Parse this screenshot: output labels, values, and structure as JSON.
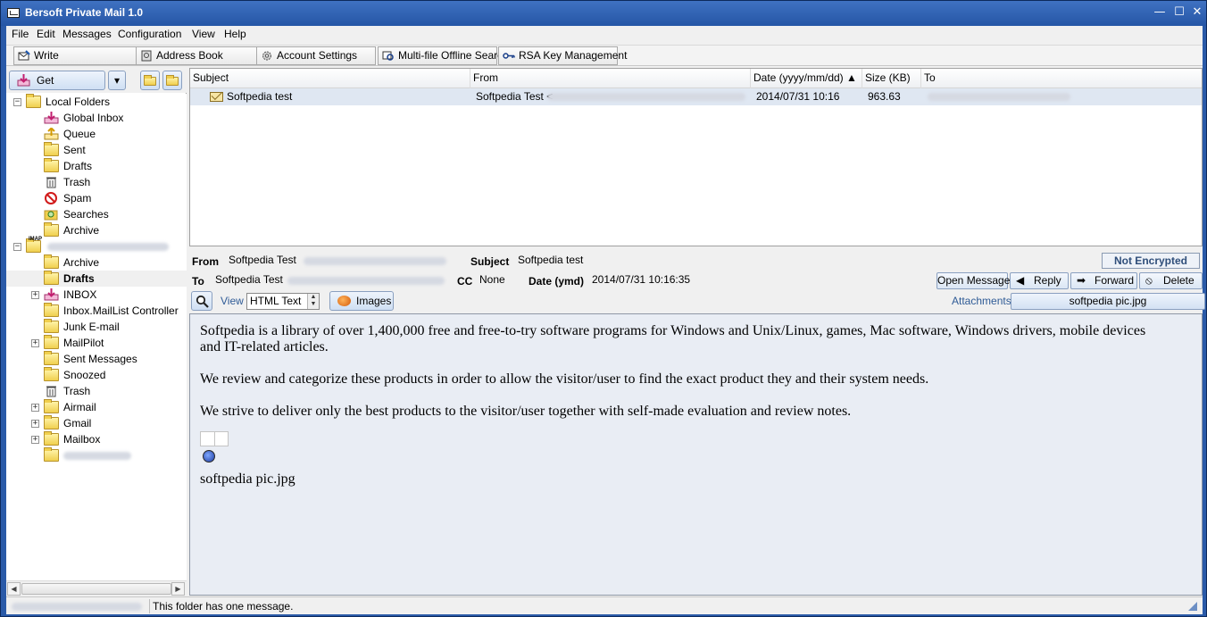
{
  "window": {
    "title": "Bersoft Private Mail 1.0",
    "min": "—",
    "max": "☐",
    "close": "✕"
  },
  "menu": [
    "File",
    "Edit",
    "Messages",
    "Configuration",
    "View",
    "Help"
  ],
  "toolbar": {
    "write": "Write",
    "address_book": "Address Book",
    "account_settings": "Account Settings",
    "offline_search": "Multi-file Offline Search",
    "rsa": "RSA Key Management"
  },
  "left": {
    "get_messages": "Get Messages",
    "dropdown_arrow": "▾",
    "local_root": "Local Folders",
    "local_folders": [
      "Global Inbox",
      "Queue",
      "Sent",
      "Drafts",
      "Trash",
      "Spam",
      "Searches",
      "Archive"
    ],
    "account_folders": [
      "Archive",
      "Drafts",
      "INBOX",
      "Inbox.MailList Controller",
      "Junk E-mail",
      "MailPilot",
      "Sent Messages",
      "Snoozed",
      "Trash",
      "Airmail",
      "Gmail",
      "Mailbox"
    ],
    "selected": "Drafts",
    "imap_badge": "IMAP",
    "expander_minus": "−",
    "expander_plus": "+",
    "scroll_left": "◀",
    "scroll_right": "▶"
  },
  "list": {
    "columns": [
      "Subject",
      "From",
      "Date (yyyy/mm/dd) ▲",
      "Size (KB)",
      "To"
    ],
    "rows": [
      {
        "subject": "Softpedia test",
        "from": "Softpedia Test <",
        "date": "2014/07/31 10:16",
        "size": "963.63"
      }
    ]
  },
  "header": {
    "from_label": "From",
    "from_value": "Softpedia Test",
    "subject_label": "Subject",
    "subject_value": "Softpedia test",
    "to_label": "To",
    "to_value": "Softpedia Test",
    "cc_label": "CC",
    "cc_value": "None",
    "date_label": "Date (ymd)",
    "date_value": "2014/07/31 10:16:35",
    "encryption": "Not Encrypted",
    "open_message": "Open Message",
    "reply": "Reply",
    "forward": "Forward",
    "delete": "Delete",
    "reply_icon": "◀",
    "forward_icon": "➡",
    "delete_icon": "⦸",
    "view_label": "View",
    "view_mode": "HTML Text",
    "spin_up": "▲",
    "spin_down": "▼",
    "images": "Images",
    "attachments_label": "Attachments",
    "attachment_file": "softpedia pic.jpg"
  },
  "body": {
    "p1": "Softpedia is a library of over 1,400,000 free and free-to-try software  programs for Windows and Unix/Linux, games, Mac software, Windows drivers, mobile devices and IT-related articles.",
    "p2": "We review and categorize these products in order to allow the visitor/user  to find the exact product they and their system needs.",
    "p3": "We strive to deliver only the best products to the visitor/user together with self-made evaluation and review notes.",
    "image_caption": "softpedia pic.jpg"
  },
  "status": {
    "message": "This folder has one message."
  },
  "colors": {
    "titlebar": "#2a5aa8",
    "selection": "#dfe7f2",
    "body_bg": "#e9edf4",
    "accent_text": "#2f5b96"
  }
}
